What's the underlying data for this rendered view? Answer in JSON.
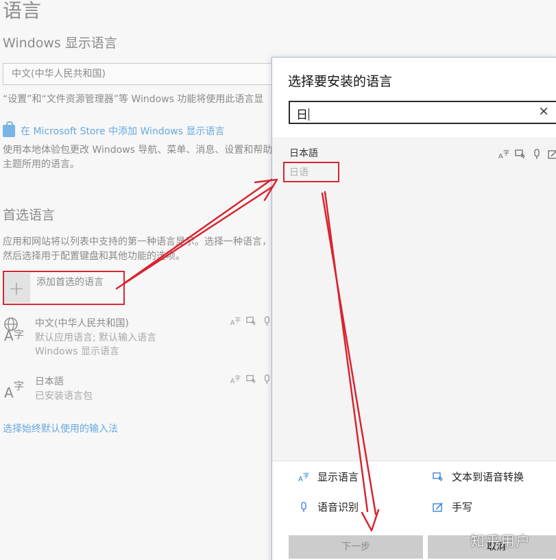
{
  "settings": {
    "title": "语言",
    "display_lang_heading": "Windows 显示语言",
    "display_lang_value": "中文(中华人民共和国)",
    "display_note": "“设置”和“文件资源管理器”等 Windows 功能将使用此语言显",
    "store_link": "在 Microsoft Store 中添加 Windows 显示语言",
    "store_desc": "使用本地体验包更改 Windows 导航、菜单、消息、设置和帮助主题所用的语言。",
    "preferred_heading": "首选语言",
    "preferred_desc": "应用和网站将以列表中支持的第一种语言显示。选择一种语言，然后选择用于配置键盘和其他功能的选项。",
    "add_label": "添加首选的语言",
    "add_symbol": "+",
    "languages": [
      {
        "name": "中文(中华人民共和国)",
        "line2": "默认应用语言; 默认输入语言",
        "line3": "Windows 显示语言"
      },
      {
        "name": "日本語",
        "line2": "已安装语言包",
        "line3": ""
      }
    ],
    "input_method_link": "选择始终默认使用的输入法"
  },
  "dialog": {
    "title": "选择要安装的语言",
    "search_value": "日",
    "clear_symbol": "×",
    "result": {
      "name": "日本語",
      "native": "日语"
    },
    "legend": {
      "display": "显示语言",
      "tts": "文本到语音转换",
      "speech": "语音识别",
      "handwriting": "手写"
    },
    "next_label": "下一步",
    "cancel_label": "取消"
  },
  "watermark": "知乎用户",
  "colors": {
    "annotation": "#d82530",
    "link": "#66a8e0",
    "accent_icon": "#2d7ad6"
  },
  "icons": [
    "store-icon",
    "language-icon",
    "display-language-icon",
    "text-to-speech-icon",
    "speech-icon",
    "handwriting-icon",
    "close-icon",
    "plus-icon"
  ]
}
